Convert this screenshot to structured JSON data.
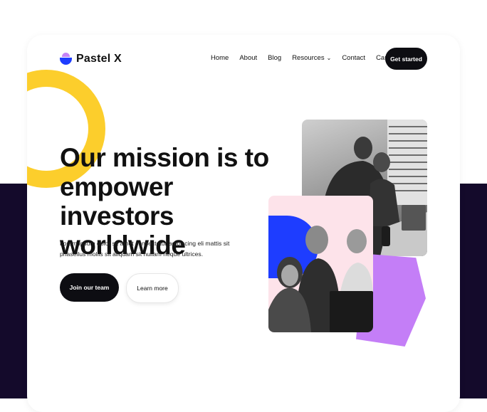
{
  "brand": {
    "name": "Pastel X"
  },
  "nav": {
    "items": [
      "Home",
      "About",
      "Blog",
      "Resources",
      "Contact",
      "Cart (1)"
    ],
    "cta": "Get started"
  },
  "hero": {
    "headline": "Our mission is to empower investors worldwide",
    "subtext": "Lorem ipsum dolor sit amet consectetur adipiscing eli mattis sit phasellus mollis sit aliquam sit nullam neque ultrices.",
    "primary_button": "Join our team",
    "secondary_button": "Learn more"
  },
  "colors": {
    "dark_background": "#140a2b",
    "accent_yellow": "#fcce2c",
    "accent_blue": "#1e3dff",
    "accent_purple": "#c47ef7",
    "accent_pink": "#fde3ea",
    "button_dark": "#0d0d12"
  }
}
